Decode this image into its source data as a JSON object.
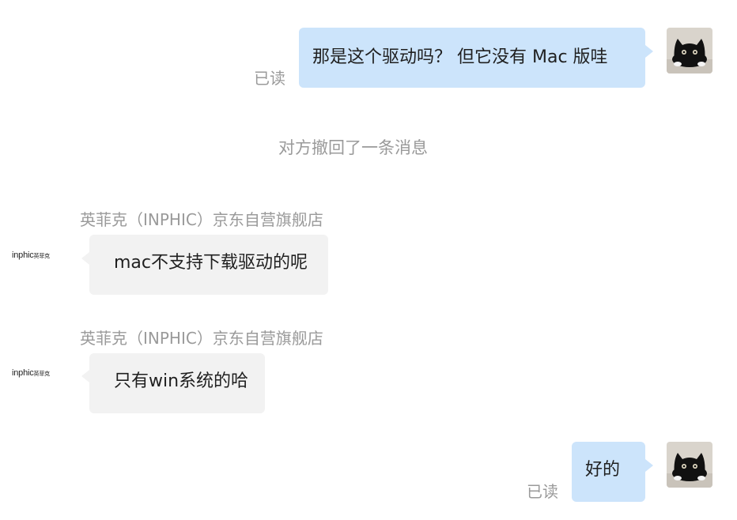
{
  "messages": {
    "m1": {
      "text": "那是这个驱动吗？ 但它没有 Mac 版哇",
      "status": "已读"
    },
    "recalled": "对方撤回了一条消息",
    "m2": {
      "sender": "英菲克（INPHIC）京东自营旗舰店",
      "text": "mac不支持下载驱动的呢"
    },
    "m3": {
      "sender": "英菲克（INPHIC）京东自营旗舰店",
      "text": "只有win系统的哈"
    },
    "m4": {
      "text": "好的",
      "status": "已读"
    }
  },
  "shop_logo": {
    "latin": "inphic",
    "cn": "英菲克"
  },
  "colors": {
    "my_bubble": "#cce4fb",
    "their_bubble": "#f2f2f2",
    "meta_text": "#9a9a9a"
  },
  "icons": {
    "my_avatar": "black-cat-avatar-icon",
    "shop_avatar": "inphic-logo-icon"
  }
}
